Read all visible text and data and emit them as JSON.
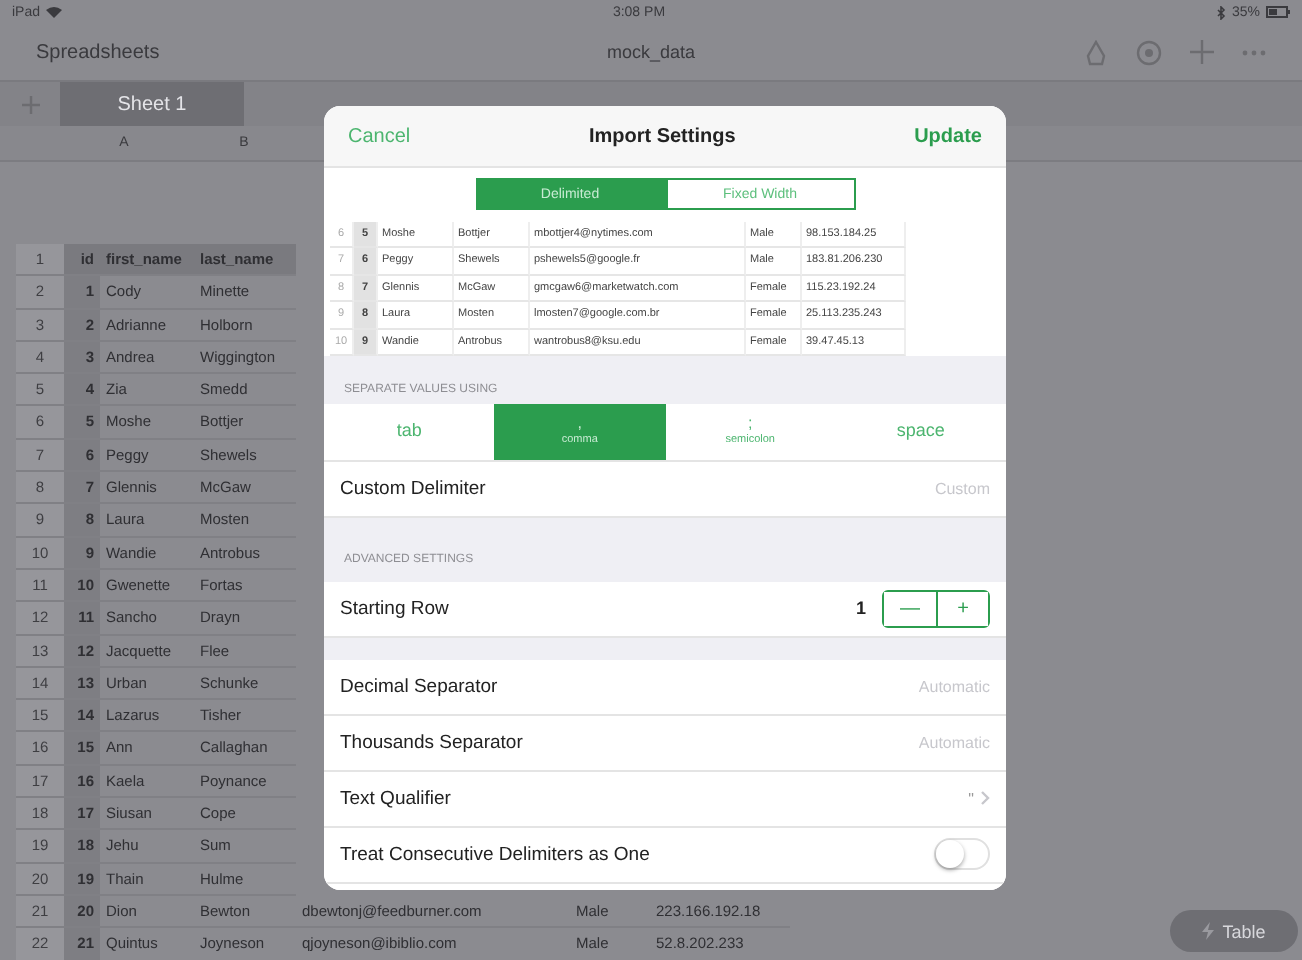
{
  "status_bar": {
    "carrier": "iPad",
    "time": "3:08 PM",
    "battery": "35%"
  },
  "toolbar": {
    "back": "Spreadsheets",
    "title": "mock_data"
  },
  "sheet_tabs": [
    {
      "label": "Sheet 1",
      "selected": true
    }
  ],
  "sheet": {
    "column_letters": [
      "A",
      "B"
    ],
    "header": {
      "number": "1",
      "cells": [
        "id",
        "first_name",
        "last_name"
      ]
    },
    "rows": [
      {
        "number": "2",
        "cells": [
          "1",
          "Cody",
          "Minette"
        ]
      },
      {
        "number": "3",
        "cells": [
          "2",
          "Adrianne",
          "Holborn"
        ]
      },
      {
        "number": "4",
        "cells": [
          "3",
          "Andrea",
          "Wiggington"
        ]
      },
      {
        "number": "5",
        "cells": [
          "4",
          "Zia",
          "Smedd"
        ]
      },
      {
        "number": "6",
        "cells": [
          "5",
          "Moshe",
          "Bottjer"
        ]
      },
      {
        "number": "7",
        "cells": [
          "6",
          "Peggy",
          "Shewels"
        ]
      },
      {
        "number": "8",
        "cells": [
          "7",
          "Glennis",
          "McGaw"
        ]
      },
      {
        "number": "9",
        "cells": [
          "8",
          "Laura",
          "Mosten"
        ]
      },
      {
        "number": "10",
        "cells": [
          "9",
          "Wandie",
          "Antrobus"
        ]
      },
      {
        "number": "11",
        "cells": [
          "10",
          "Gwenette",
          "Fortas"
        ]
      },
      {
        "number": "12",
        "cells": [
          "11",
          "Sancho",
          "Drayn"
        ]
      },
      {
        "number": "13",
        "cells": [
          "12",
          "Jacquette",
          "Flee"
        ]
      },
      {
        "number": "14",
        "cells": [
          "13",
          "Urban",
          "Schunke"
        ]
      },
      {
        "number": "15",
        "cells": [
          "14",
          "Lazarus",
          "Tisher"
        ]
      },
      {
        "number": "16",
        "cells": [
          "15",
          "Ann",
          "Callaghan"
        ]
      },
      {
        "number": "17",
        "cells": [
          "16",
          "Kaela",
          "Poynance"
        ]
      },
      {
        "number": "18",
        "cells": [
          "17",
          "Siusan",
          "Cope"
        ]
      },
      {
        "number": "19",
        "cells": [
          "18",
          "Jehu",
          "Sum"
        ]
      },
      {
        "number": "20",
        "cells": [
          "19",
          "Thain",
          "Hulme"
        ]
      },
      {
        "number": "21",
        "cells": [
          "20",
          "Dion",
          "Bewton",
          "dbewtonj@feedburner.com",
          "Male",
          "223.166.192.18"
        ]
      },
      {
        "number": "22",
        "cells": [
          "21",
          "Quintus",
          "Joyneson",
          "qjoyneson@ibiblio.com",
          "Male",
          "52.8.202.233"
        ]
      }
    ]
  },
  "table_button": {
    "label": "Table"
  },
  "dialog": {
    "cancel": "Cancel",
    "title": "Import Settings",
    "update": "Update",
    "modes": [
      {
        "label": "Delimited",
        "selected": true
      },
      {
        "label": "Fixed Width",
        "selected": false
      }
    ],
    "preview": {
      "rows": [
        {
          "number": "6",
          "cells": [
            "5",
            "Moshe",
            "Bottjer",
            "mbottjer4@nytimes.com",
            "Male",
            "98.153.184.25"
          ]
        },
        {
          "number": "7",
          "cells": [
            "6",
            "Peggy",
            "Shewels",
            "pshewels5@google.fr",
            "Male",
            "183.81.206.230"
          ]
        },
        {
          "number": "8",
          "cells": [
            "7",
            "Glennis",
            "McGaw",
            "gmcgaw6@marketwatch.com",
            "Female",
            "115.23.192.24"
          ]
        },
        {
          "number": "9",
          "cells": [
            "8",
            "Laura",
            "Mosten",
            "lmosten7@google.com.br",
            "Female",
            "25.113.235.243"
          ]
        },
        {
          "number": "10",
          "cells": [
            "9",
            "Wandie",
            "Antrobus",
            "wantrobus8@ksu.edu",
            "Female",
            "39.47.45.13"
          ]
        }
      ]
    },
    "separate_header": "SEPARATE VALUES USING",
    "delimiters": [
      {
        "label": "tab",
        "selected": false
      },
      {
        "symbol": ",",
        "label": "comma",
        "selected": true
      },
      {
        "symbol": ";",
        "label": "semicolon",
        "selected": false
      },
      {
        "label": "space",
        "selected": false
      }
    ],
    "custom_delimiter": {
      "label": "Custom Delimiter",
      "placeholder": "Custom"
    },
    "sections": [
      {
        "header": "ADVANCED SETTINGS",
        "rows": [
          {
            "kind": "stepper",
            "label": "Starting Row",
            "value": "1",
            "minus": "—",
            "plus": "+"
          }
        ]
      },
      {
        "rows": [
          {
            "kind": "value",
            "label": "Decimal Separator",
            "value": "Automatic"
          },
          {
            "kind": "value",
            "label": "Thousands Separator",
            "value": "Automatic"
          },
          {
            "kind": "disclosure",
            "label": "Text Qualifier",
            "value": "\""
          },
          {
            "kind": "toggle",
            "label": "Treat Consecutive Delimiters as One",
            "on": false
          }
        ]
      }
    ]
  }
}
